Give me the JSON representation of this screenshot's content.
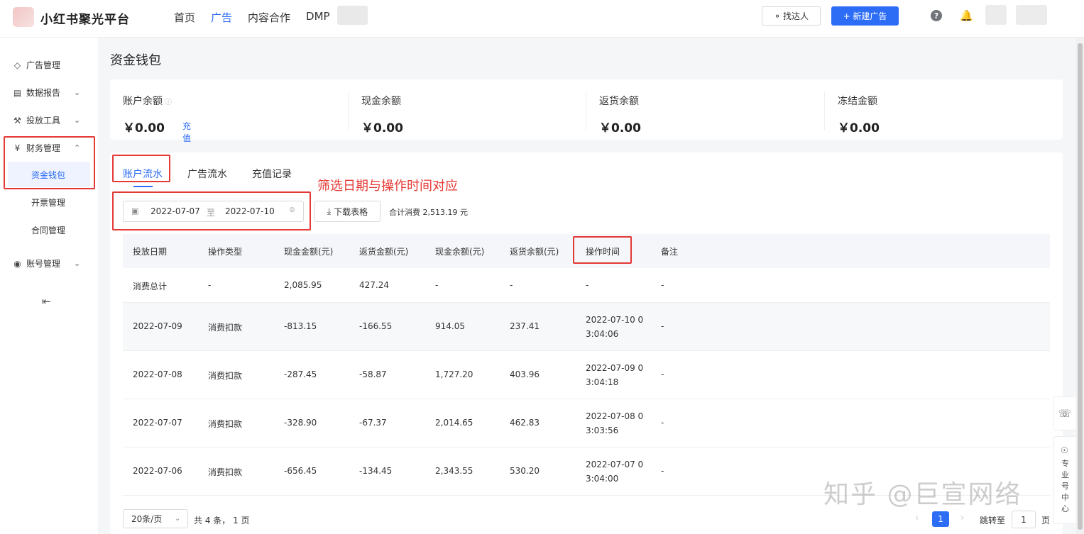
{
  "app": {
    "name": "小红书聚光平台"
  },
  "topnav": {
    "items": [
      "首页",
      "广告",
      "内容合作",
      "DMP"
    ],
    "active": "广告"
  },
  "header": {
    "find_talent": "找达人",
    "new_ad": "+ 新建广告"
  },
  "sidebar": {
    "ad_manage": "广告管理",
    "data_report": "数据报告",
    "tools": "投放工具",
    "finance": "财务管理",
    "wallet": "资金钱包",
    "invoice": "开票管理",
    "contract": "合同管理",
    "account": "账号管理"
  },
  "page": {
    "title": "资金钱包"
  },
  "summary": [
    {
      "label": "账户余额",
      "value": "￥0.00",
      "link": "充值"
    },
    {
      "label": "现金余额",
      "value": "￥0.00"
    },
    {
      "label": "返货余额",
      "value": "￥0.00"
    },
    {
      "label": "冻结金额",
      "value": "￥0.00"
    }
  ],
  "tabs": [
    "账户流水",
    "广告流水",
    "充值记录"
  ],
  "annotation": "筛选日期与操作时间对应",
  "filter": {
    "start": "2022-07-07",
    "to": "至",
    "end": "2022-07-10"
  },
  "download_label": "下载表格",
  "total_consume": "合计消费 2,513.19 元",
  "table": {
    "headers": [
      "投放日期",
      "操作类型",
      "现金金额(元)",
      "返货金额(元)",
      "现金余额(元)",
      "返货余额(元)",
      "操作时间",
      "备注"
    ],
    "rows": [
      [
        "消费总计",
        "-",
        "2,085.95",
        "427.24",
        "-",
        "-",
        "-",
        "-"
      ],
      [
        "2022-07-09",
        "消费扣款",
        "-813.15",
        "-166.55",
        "914.05",
        "237.41",
        "2022-07-10 03:04:06",
        "-"
      ],
      [
        "2022-07-08",
        "消费扣款",
        "-287.45",
        "-58.87",
        "1,727.20",
        "403.96",
        "2022-07-09 03:04:18",
        "-"
      ],
      [
        "2022-07-07",
        "消费扣款",
        "-328.90",
        "-67.37",
        "2,014.65",
        "462.83",
        "2022-07-08 03:03:56",
        "-"
      ],
      [
        "2022-07-06",
        "消费扣款",
        "-656.45",
        "-134.45",
        "2,343.55",
        "530.20",
        "2022-07-07 03:04:00",
        "-"
      ]
    ]
  },
  "pager": {
    "page_size": "20条/页",
    "count": "共 4 条， 1 页",
    "current": "1",
    "jump_label": "跳转至",
    "jump_value": "1",
    "jump_unit": "页"
  },
  "float": {
    "zh_label": "专业号中心"
  },
  "watermark": "知乎 @巨宣网络",
  "colors": {
    "accent": "#2d6df6",
    "highlight": "#e53935"
  }
}
